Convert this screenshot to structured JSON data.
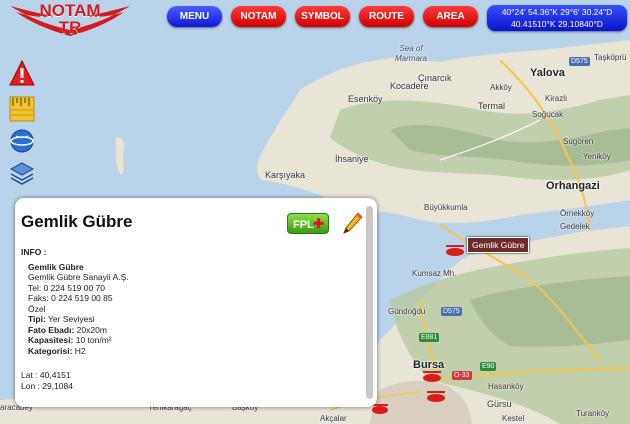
{
  "app": {
    "logo_line1": "NOTAM",
    "logo_line2": "TR"
  },
  "toolbar": {
    "menu": "MENU",
    "notam": "NOTAM",
    "symbol": "SYMBOL",
    "route": "ROUTE",
    "area": "AREA",
    "coord_line1": "40°24' 54.36\"K 29°6' 30.24\"D",
    "coord_line2": "40.41510°K 29.10840°D"
  },
  "colors": {
    "blue_button": "#1019d8",
    "red_button": "#d00000",
    "fpl_green": "#3a9a12",
    "marker_label_bg": "#6e2a2a"
  },
  "side_tools": [
    "warning-icon",
    "ruler-icon",
    "globe-icon",
    "layers-icon"
  ],
  "map": {
    "sea_label_1": "Sea of",
    "sea_label_2": "Marmara",
    "places": {
      "yalova": "Yalova",
      "cinarcik": "Çınarcık",
      "kocadere": "Kocadere",
      "akkoy": "Akköy",
      "esenkoy": "Esenköy",
      "termal": "Termal",
      "kirazli": "Kirazlı",
      "sogucak": "Soğucak",
      "sugoren": "Sugören",
      "yenikoy": "Yeniköy",
      "ihsaniye": "İhsaniye",
      "karsiyaka": "Karşıyaka",
      "orhangazi": "Orhangazi",
      "buyukkumla": "Büyükkumla",
      "ornekkoy": "Örnekköy",
      "gedelek": "Gedelek",
      "kumsaz": "Kumsaz Mh.",
      "gundogdu": "Gündoğdu",
      "bursa": "Bursa",
      "hasankoy": "Hasanköy",
      "gursu": "Gürsu",
      "turanokoy": "Turanköy",
      "kestel": "Kestel",
      "karacabey": "aracabey",
      "baskoy": "Başköy",
      "yenikaragac": "Yenikaragaç",
      "akcalar": "Akçalar",
      "tasköprü": "Taşköprü"
    },
    "roads": {
      "d575a": "D575",
      "d575b": "D575",
      "e881": "E881",
      "e90": "E90",
      "o33": "O-33"
    },
    "marker_label": "Gemlik Gübre"
  },
  "popup": {
    "title": "Gemlik Gübre",
    "fpl_label": "FPL",
    "info_heading": "INFO :",
    "name": "Gemlik Gübre",
    "company": "Gemlik Gübre Sanayii A.Ş.",
    "tel": "Tel: 0 224 519 00 70",
    "fax": "Faks: 0 224 519 00 85",
    "ownership": "Özel",
    "type_label": "Tipi:",
    "type_value": "Yer Seviyesi",
    "size_label": "Fato Ebadı:",
    "size_value": "20x20m",
    "capacity_label": "Kapasitesi:",
    "capacity_value": "10 ton/m²",
    "category_label": "Kategorisi:",
    "category_value": "H2",
    "lat": "Lat : 40,4151",
    "lon": "Lon : 29,1084"
  }
}
